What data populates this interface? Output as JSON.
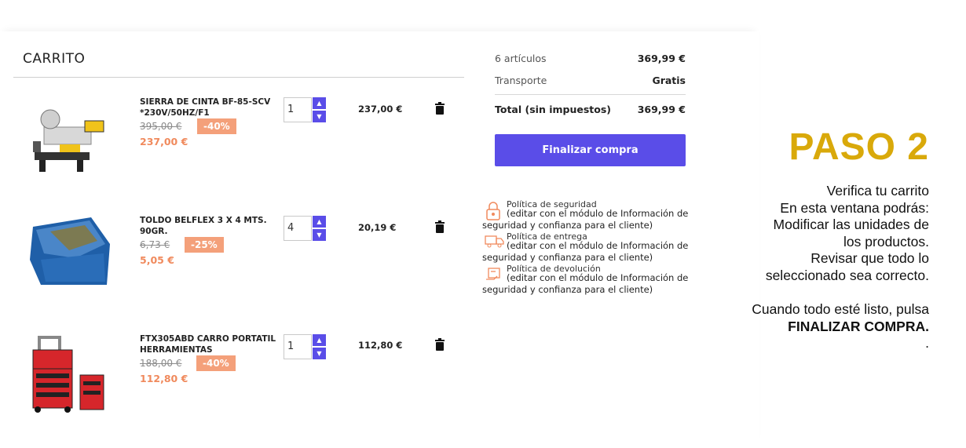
{
  "cart": {
    "title": "CARRITO",
    "items": [
      {
        "name": "SIERRA DE CINTA BF-85-SCV *230V/50HZ/F1",
        "old_price": "395,00 €",
        "discount": "-40%",
        "price": "237,00 €",
        "quantity": "1",
        "total": "237,00 €",
        "image": "band-saw-image"
      },
      {
        "name": "TOLDO BELFLEX 3 X 4 MTS. 90GR.",
        "old_price": "6,73 €",
        "discount": "-25%",
        "price": "5,05 €",
        "quantity": "4",
        "total": "20,19 €",
        "image": "tarp-image"
      },
      {
        "name": "FTX305ABD CARRO PORTATIL HERRAMIENTAS",
        "old_price": "188,00 €",
        "discount": "-40%",
        "price": "112,80 €",
        "quantity": "1",
        "total": "112,80 €",
        "image": "tool-trolley-image"
      }
    ]
  },
  "summary": {
    "items_label": "6 artículos",
    "items_value": "369,99 €",
    "shipping_label": "Transporte",
    "shipping_value": "Gratis",
    "total_label": "Total  (sin impuestos)",
    "total_value": "369,99 €",
    "checkout_label": "Finalizar compra"
  },
  "policies": [
    {
      "title": "Política de seguridad",
      "desc": "(editar con el módulo de Información de seguridad y confianza para el cliente)",
      "icon": "lock-icon"
    },
    {
      "title": "Política de entrega",
      "desc": "(editar con el módulo de Información de seguridad y confianza para el cliente)",
      "icon": "truck-icon"
    },
    {
      "title": "Política de devolución",
      "desc": "(editar con el módulo de Información de seguridad y confianza para el cliente)",
      "icon": "return-icon"
    }
  ],
  "step": {
    "title": "PASO 2",
    "lines": [
      "Verifica tu carrito",
      "En esta ventana podrás:",
      "Modificar las unidades de",
      "los productos.",
      "Revisar que todo lo",
      "seleccionado sea correcto.",
      "",
      "Cuando todo esté listo, pulsa"
    ],
    "bold_line": "FINALIZAR COMPRA.",
    "last_line": "."
  },
  "colors": {
    "accent": "#5a4de8",
    "discount": "#f4a07a",
    "price": "#f08a5d",
    "step_title": "#d9a90a",
    "policy_icon": "#f08a5d"
  }
}
